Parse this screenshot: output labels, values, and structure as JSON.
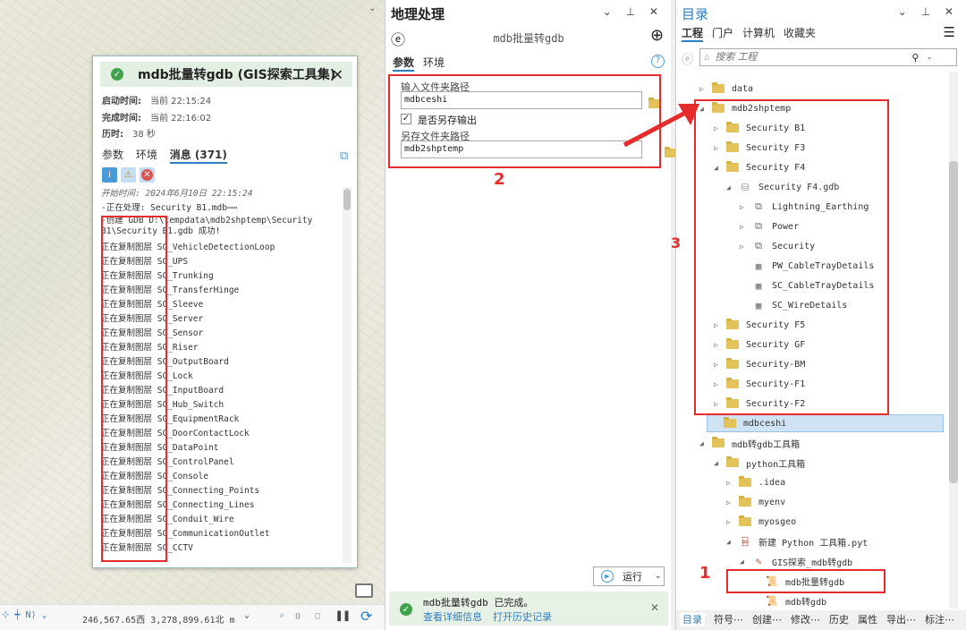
{
  "popup": {
    "title": "mdb批量转gdb (GIS探索工具集)",
    "meta": [
      {
        "label": "启动时间:",
        "value": "当前 22:15:24"
      },
      {
        "label": "完成时间:",
        "value": "当前 22:16:02"
      },
      {
        "label": "历时:",
        "value": "38 秒"
      }
    ],
    "tabs": [
      "参数",
      "环境",
      "消息 (371)"
    ],
    "start_line": "开始时间: 2024年6月10日 22:15:24",
    "lines": [
      "-正在处理: Security B1.mdb⋯⋯",
      "  -创建 GDB D:\\tempdata\\mdb2shptemp\\Security",
      "B1\\Security B1.gdb 成功!"
    ],
    "copy_prefix": "正在复制图层",
    "layers": [
      "SC_VehicleDetectionLoop",
      "SC_UPS",
      "SC_Trunking",
      "SC_TransferHinge",
      "SC_Sleeve",
      "SC_Server",
      "SC_Sensor",
      "SC_Riser",
      "SC_OutputBoard",
      "SC_Lock",
      "SC_InputBoard",
      "SC_Hub_Switch",
      "SC_EquipmentRack",
      "SC_DoorContactLock",
      "SC_DataPoint",
      "SC_ControlPanel",
      "SC_Console",
      "SC_Connecting_Points",
      "SC_Connecting_Lines",
      "SC_Conduit_Wire",
      "SC_CommunicationOutlet",
      "SC_CCTV"
    ]
  },
  "statusbar": {
    "coords": "246,567.65西 3,278,899.61北 m",
    "selected_count": "0"
  },
  "gp": {
    "title": "地理处理",
    "tool": "mdb批量转gdb",
    "tabs": [
      "参数",
      "环境"
    ],
    "input_label": "输入文件夹路径",
    "input_value": "mdbceshi",
    "checkbox_label": "是否另存输出",
    "checkbox_checked": true,
    "output_label": "另存文件夹路径",
    "output_value": "mdb2shptemp",
    "run": "运行",
    "done_msg": "mdb批量转gdb 已完成。",
    "link_details": "查看详细信息",
    "link_history": "打开历史记录"
  },
  "catalog": {
    "title": "目录",
    "tabs": [
      "工程",
      "门户",
      "计算机",
      "收藏夹"
    ],
    "search_placeholder": "搜索 工程",
    "tree": [
      {
        "label": "data",
        "lvl": 0,
        "arrow": "▷",
        "icon": "folder"
      },
      {
        "label": "mdb2shptemp",
        "lvl": 0,
        "arrow": "◢",
        "icon": "folder"
      },
      {
        "label": "Security B1",
        "lvl": 1,
        "arrow": "▷",
        "icon": "folder"
      },
      {
        "label": "Security F3",
        "lvl": 1,
        "arrow": "▷",
        "icon": "folder"
      },
      {
        "label": "Security F4",
        "lvl": 1,
        "arrow": "◢",
        "icon": "folder"
      },
      {
        "label": "Security F4.gdb",
        "lvl": 2,
        "arrow": "◢",
        "icon": "gdb"
      },
      {
        "label": "Lightning_Earthing",
        "lvl": 3,
        "arrow": "▷",
        "icon": "dataset"
      },
      {
        "label": "Power",
        "lvl": 3,
        "arrow": "▷",
        "icon": "dataset"
      },
      {
        "label": "Security",
        "lvl": 3,
        "arrow": "▷",
        "icon": "dataset"
      },
      {
        "label": "PW_CableTrayDetails",
        "lvl": 3,
        "arrow": "",
        "icon": "table"
      },
      {
        "label": "SC_CableTrayDetails",
        "lvl": 3,
        "arrow": "",
        "icon": "table"
      },
      {
        "label": "SC_WireDetails",
        "lvl": 3,
        "arrow": "",
        "icon": "table"
      },
      {
        "label": "Security F5",
        "lvl": 1,
        "arrow": "▷",
        "icon": "folder"
      },
      {
        "label": "Security GF",
        "lvl": 1,
        "arrow": "▷",
        "icon": "folder"
      },
      {
        "label": "Security-BM",
        "lvl": 1,
        "arrow": "▷",
        "icon": "folder"
      },
      {
        "label": "Security-F1",
        "lvl": 1,
        "arrow": "▷",
        "icon": "folder"
      },
      {
        "label": "Security-F2",
        "lvl": 1,
        "arrow": "▷",
        "icon": "folder"
      },
      {
        "label": "mdbceshi",
        "lvl": 0,
        "arrow": "",
        "icon": "folder",
        "selected": true
      },
      {
        "label": "mdb转gdb工具箱",
        "lvl": 0,
        "arrow": "◢",
        "icon": "folder"
      },
      {
        "label": "python工具箱",
        "lvl": 1,
        "arrow": "◢",
        "icon": "folder"
      },
      {
        "label": ".idea",
        "lvl": 2,
        "arrow": "▷",
        "icon": "folder"
      },
      {
        "label": "myenv",
        "lvl": 2,
        "arrow": "▷",
        "icon": "folder"
      },
      {
        "label": "myosgeo",
        "lvl": 2,
        "arrow": "▷",
        "icon": "folder"
      },
      {
        "label": "新建 Python 工具箱.pyt",
        "lvl": 2,
        "arrow": "◢",
        "icon": "toolbox"
      },
      {
        "label": "GIS探索_mdb转gdb",
        "lvl": 3,
        "arrow": "◢",
        "icon": "toolset"
      },
      {
        "label": "mdb批量转gdb",
        "lvl": 4,
        "arrow": "",
        "icon": "script"
      },
      {
        "label": "mdb转gdb",
        "lvl": 4,
        "arrow": "",
        "icon": "script"
      }
    ],
    "bottom_tabs": [
      "目录",
      "符号⋯",
      "创建⋯",
      "修改⋯",
      "历史",
      "属性",
      "导出⋯",
      "标注⋯"
    ]
  },
  "annotations": {
    "n1": "1",
    "n2": "2",
    "n3": "3",
    "color": "#e52b2b"
  }
}
